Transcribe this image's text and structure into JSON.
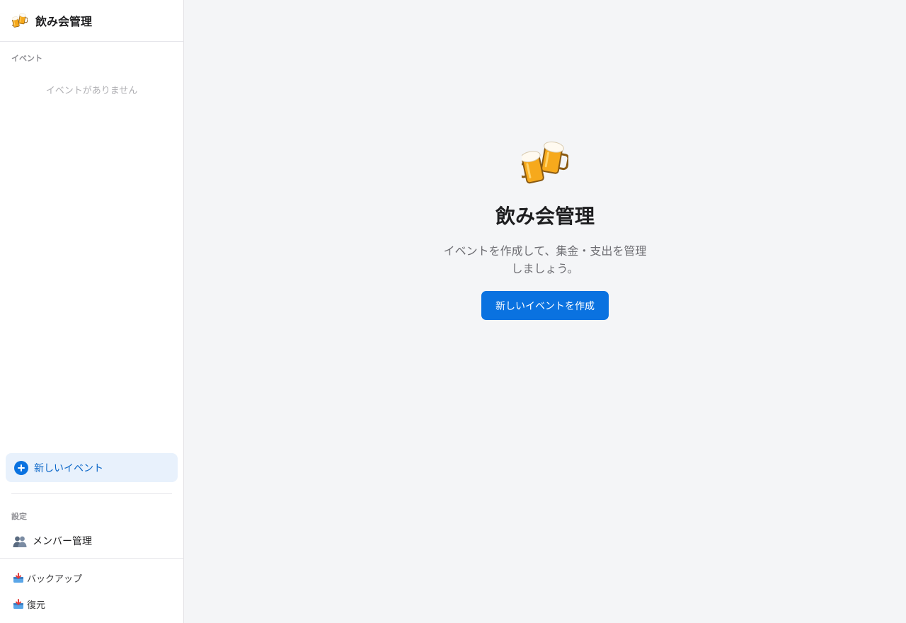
{
  "app": {
    "title": "飲み会管理"
  },
  "sidebar": {
    "events_label": "イベント",
    "empty_events": "イベントがありません",
    "new_event_label": "新しいイベント",
    "settings_label": "設定",
    "members_label": "メンバー管理",
    "backup_label": "バックアップ",
    "restore_label": "復元"
  },
  "main": {
    "title": "飲み会管理",
    "description": "イベントを作成して、集金・支出を管理しましょう。",
    "cta_label": "新しいイベントを作成"
  },
  "icons": {
    "brand": "beer-mugs-icon",
    "hero": "beer-mugs-icon",
    "new_event": "plus-circle-icon",
    "members": "people-icon",
    "backup": "tray-icon",
    "restore": "tray-icon"
  },
  "colors": {
    "accent": "#0a72e0",
    "accent_soft": "#e8f1fc",
    "sidebar_bg": "#ffffff",
    "main_bg": "#f4f5f7"
  }
}
